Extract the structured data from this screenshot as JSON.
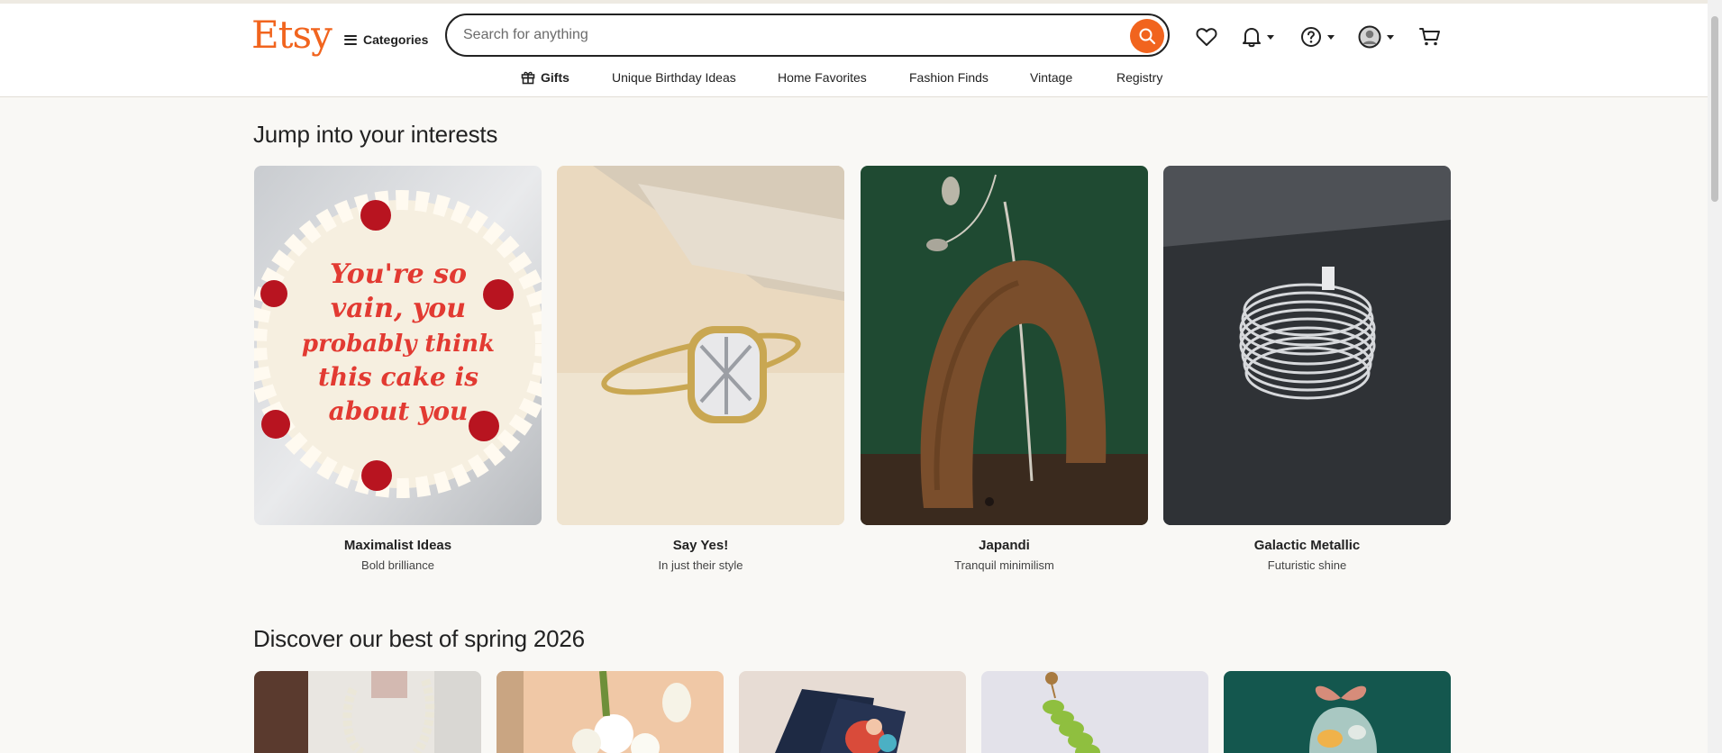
{
  "brand": {
    "logo_text": "Etsy",
    "accent_color": "#f1641e"
  },
  "header": {
    "categories_label": "Categories",
    "search": {
      "placeholder": "Search for anything",
      "value": ""
    },
    "icons": [
      "search-icon",
      "heart-icon",
      "bell-icon",
      "help-icon",
      "avatar-icon",
      "cart-icon"
    ]
  },
  "subnav": {
    "items": [
      {
        "label": "Gifts",
        "icon": "gift-icon"
      },
      {
        "label": "Unique Birthday Ideas"
      },
      {
        "label": "Home Favorites"
      },
      {
        "label": "Fashion Finds"
      },
      {
        "label": "Vintage"
      },
      {
        "label": "Registry"
      }
    ]
  },
  "interests": {
    "heading": "Jump into your interests",
    "cards": [
      {
        "title": "Maximalist Ideas",
        "subtitle": "Bold brilliance",
        "image_text": [
          "You're so",
          "vain, you",
          "probably think",
          "this cake is",
          "about you"
        ]
      },
      {
        "title": "Say Yes!",
        "subtitle": "In just their style"
      },
      {
        "title": "Japandi",
        "subtitle": "Tranquil minimilism"
      },
      {
        "title": "Galactic Metallic",
        "subtitle": "Futuristic shine"
      }
    ]
  },
  "spring": {
    "heading": "Discover our best of spring 2026",
    "tile_count": 5
  }
}
